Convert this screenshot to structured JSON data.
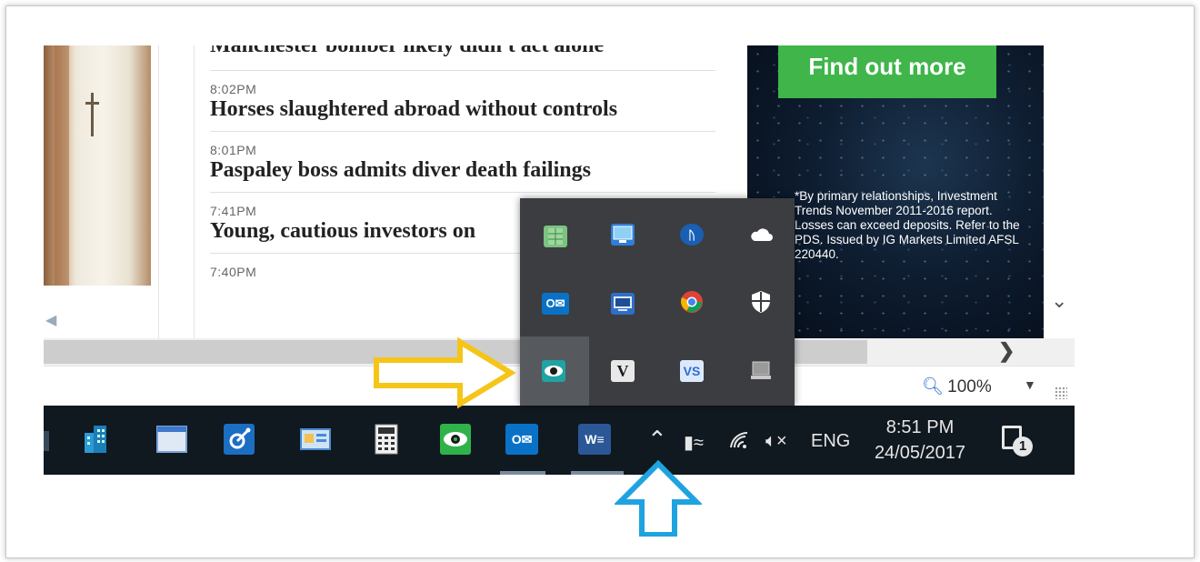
{
  "news": {
    "items": [
      {
        "time": "",
        "headline": "Manchester bomber likely didn't act alone"
      },
      {
        "time": "8:02PM",
        "headline": "Horses slaughtered abroad without controls"
      },
      {
        "time": "8:01PM",
        "headline": "Paspaley boss admits diver death failings"
      },
      {
        "time": "7:41PM",
        "headline": "Young, cautious investors on"
      },
      {
        "time": "7:40PM",
        "headline": ""
      }
    ]
  },
  "ad": {
    "button_label": "Find out more",
    "disclaimer": "*By primary relationships, Investment Trends November 2011-2016 report. Losses can exceed deposits. Refer to the PDS. Issued by IG Markets Limited AFSL 220440."
  },
  "statusbar": {
    "zoom": "100%"
  },
  "taskbar": {
    "pinned_icons": [
      "building-icon",
      "window-icon",
      "satellite-icon",
      "control-panel-icon",
      "calculator-icon",
      "eye-app-icon",
      "outlook-icon",
      "word-icon"
    ],
    "tray": {
      "language": "ENG",
      "time": "8:51 PM",
      "date": "24/05/2017",
      "notification_count": "1"
    }
  },
  "tray_overflow": {
    "icons": [
      "spreadsheet-icon",
      "network-monitor-icon",
      "bluetooth-icon",
      "onedrive-icon",
      "outlook-tray-icon",
      "presentation-icon",
      "chrome-icon",
      "defender-icon",
      "eye-tray-icon",
      "v-app-icon",
      "vs-app-icon",
      "laptop-icon"
    ]
  },
  "colors": {
    "ad_button": "#3fb54a",
    "taskbar": "#101820",
    "popup": "#3b3d40",
    "yellow_arrow": "#f5c518",
    "blue_arrow": "#1fa3e0"
  }
}
